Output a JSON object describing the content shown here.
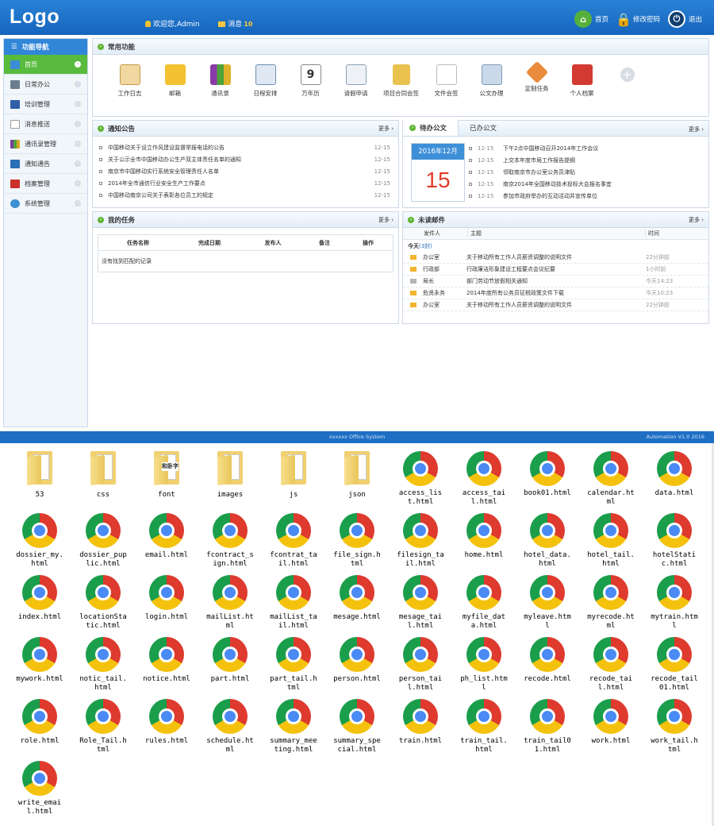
{
  "header": {
    "logo": "Logo",
    "welcome": "欢迎您,Admin",
    "messages_label": "消息",
    "messages_count": "10",
    "home": "首页",
    "change_password": "修改密码",
    "logout": "退出"
  },
  "sidebar": {
    "title": "功能导航",
    "items": [
      {
        "label": "首页",
        "active": true
      },
      {
        "label": "日常办公"
      },
      {
        "label": "培训管理"
      },
      {
        "label": "消息推送"
      },
      {
        "label": "通讯录管理"
      },
      {
        "label": "通知通告"
      },
      {
        "label": "档案管理"
      },
      {
        "label": "系统管理"
      }
    ]
  },
  "common": {
    "title": "常用功能",
    "items": [
      "工作日志",
      "邮箱",
      "通讯录",
      "日程安排",
      "万年历",
      "请假申请",
      "项目合同会签",
      "文件会签",
      "公文办理",
      "定制任务",
      "个人档案"
    ]
  },
  "notice": {
    "title": "通知公告",
    "more": "更多",
    "rows": [
      {
        "text": "中国移动关于设立作风建设监督举报电话的公告",
        "date": "12-15"
      },
      {
        "text": "关于公示全市中国移动办公生产双主体责任名单的通知",
        "date": "12-15"
      },
      {
        "text": "南京市中国移动实行系统安全管理责任人名单",
        "date": "12-15"
      },
      {
        "text": "2014年全市通信行业安全生产工作要点",
        "date": "12-15"
      },
      {
        "text": "中国移动南京公司关于表彰各位员工的规定",
        "date": "12-15"
      }
    ]
  },
  "docs": {
    "tab_todo": "待办公文",
    "tab_done": "已办公文",
    "more": "更多",
    "calendar_month": "2016年12月",
    "calendar_day": "15",
    "rows": [
      {
        "date": "12-15",
        "text": "下午2点中国移动召开2014年工作会议"
      },
      {
        "date": "12-15",
        "text": "上交本年度市局工作报告提纲"
      },
      {
        "date": "12-15",
        "text": "领取南京市办公室公务员津贴"
      },
      {
        "date": "12-15",
        "text": "南京2014年全国移动技术投标大会报名事宜"
      },
      {
        "date": "12-15",
        "text": "参加市政府举办的互动活动并宣传单位"
      }
    ]
  },
  "tasks": {
    "title": "我的任务",
    "more": "更多",
    "columns": [
      "任务名称",
      "完成日期",
      "发布人",
      "备注",
      "操作"
    ],
    "empty": "没有找到匹配的记录"
  },
  "mail": {
    "title": "未读邮件",
    "more": "更多",
    "columns": [
      "发件人",
      "主题",
      "时间"
    ],
    "today_label": "今天",
    "today_count": "(3封)",
    "rows": [
      {
        "sender": "办公室",
        "subject": "关于移动所有工作人员薪资调整的说明文件",
        "time": "22分钟前",
        "read": false
      },
      {
        "sender": "行政部",
        "subject": "行政廉洁形象建设工程要点会议纪要",
        "time": "1小时前",
        "read": false
      },
      {
        "sender": "局长",
        "subject": "部门劳动节放假相关通知",
        "time": "今天14:23",
        "read": true
      },
      {
        "sender": "危贤永务",
        "subject": "2014年度所有公务员征税政策文件下载",
        "time": "今天10:23",
        "read": false
      },
      {
        "sender": "办公室",
        "subject": "关于移动所有工作人员薪资调整的说明文件",
        "time": "22分钟前",
        "read": false
      }
    ]
  },
  "footer": {
    "center": "xxxxxx Office System",
    "right": "Automation V1.0 2016"
  },
  "desktop": {
    "files": [
      {
        "name": "53",
        "kind": "folder"
      },
      {
        "name": "css",
        "kind": "folder"
      },
      {
        "name": "font",
        "kind": "folder",
        "tag": "和卧字"
      },
      {
        "name": "images",
        "kind": "folder"
      },
      {
        "name": "js",
        "kind": "folder"
      },
      {
        "name": "json",
        "kind": "folder"
      },
      {
        "name": "access_list.html",
        "kind": "chrome"
      },
      {
        "name": "access_tail.html",
        "kind": "chrome"
      },
      {
        "name": "book01.html",
        "kind": "chrome"
      },
      {
        "name": "calendar.html",
        "kind": "chrome"
      },
      {
        "name": "data.html",
        "kind": "chrome"
      },
      {
        "name": "dossier_my.html",
        "kind": "chrome"
      },
      {
        "name": "dossier_puplic.html",
        "kind": "chrome"
      },
      {
        "name": "email.html",
        "kind": "chrome"
      },
      {
        "name": "fcontract_sign.html",
        "kind": "chrome"
      },
      {
        "name": "fcontrat_tail.html",
        "kind": "chrome"
      },
      {
        "name": "file_sign.html",
        "kind": "chrome"
      },
      {
        "name": "filesign_tail.html",
        "kind": "chrome"
      },
      {
        "name": "home.html",
        "kind": "chrome"
      },
      {
        "name": "hotel_data.html",
        "kind": "chrome"
      },
      {
        "name": "hotel_tail.html",
        "kind": "chrome"
      },
      {
        "name": "hotelStatic.html",
        "kind": "chrome"
      },
      {
        "name": "index.html",
        "kind": "chrome"
      },
      {
        "name": "locationStatic.html",
        "kind": "chrome"
      },
      {
        "name": "login.html",
        "kind": "chrome"
      },
      {
        "name": "mailList.html",
        "kind": "chrome"
      },
      {
        "name": "mailList_tail.html",
        "kind": "chrome"
      },
      {
        "name": "mesage.html",
        "kind": "chrome"
      },
      {
        "name": "mesage_tail.html",
        "kind": "chrome"
      },
      {
        "name": "myfile_data.html",
        "kind": "chrome"
      },
      {
        "name": "myleave.html",
        "kind": "chrome"
      },
      {
        "name": "myrecode.html",
        "kind": "chrome"
      },
      {
        "name": "mytrain.html",
        "kind": "chrome"
      },
      {
        "name": "mywork.html",
        "kind": "chrome"
      },
      {
        "name": "notic_tail.html",
        "kind": "chrome"
      },
      {
        "name": "notice.html",
        "kind": "chrome"
      },
      {
        "name": "part.html",
        "kind": "chrome"
      },
      {
        "name": "part_tail.html",
        "kind": "chrome"
      },
      {
        "name": "person.html",
        "kind": "chrome"
      },
      {
        "name": "person_tail.html",
        "kind": "chrome"
      },
      {
        "name": "ph_list.html",
        "kind": "chrome"
      },
      {
        "name": "recode.html",
        "kind": "chrome"
      },
      {
        "name": "recode_tail.html",
        "kind": "chrome"
      },
      {
        "name": "recode_tail01.html",
        "kind": "chrome"
      },
      {
        "name": "role.html",
        "kind": "chrome"
      },
      {
        "name": "Role_Tail.html",
        "kind": "chrome"
      },
      {
        "name": "rules.html",
        "kind": "chrome"
      },
      {
        "name": "schedule.html",
        "kind": "chrome"
      },
      {
        "name": "summary_meeting.html",
        "kind": "chrome"
      },
      {
        "name": "summary_special.html",
        "kind": "chrome"
      },
      {
        "name": "train.html",
        "kind": "chrome"
      },
      {
        "name": "train_tail.html",
        "kind": "chrome"
      },
      {
        "name": "train_tail01.html",
        "kind": "chrome"
      },
      {
        "name": "work.html",
        "kind": "chrome"
      },
      {
        "name": "work_tail.html",
        "kind": "chrome"
      },
      {
        "name": "write_email.html",
        "kind": "chrome"
      }
    ]
  }
}
